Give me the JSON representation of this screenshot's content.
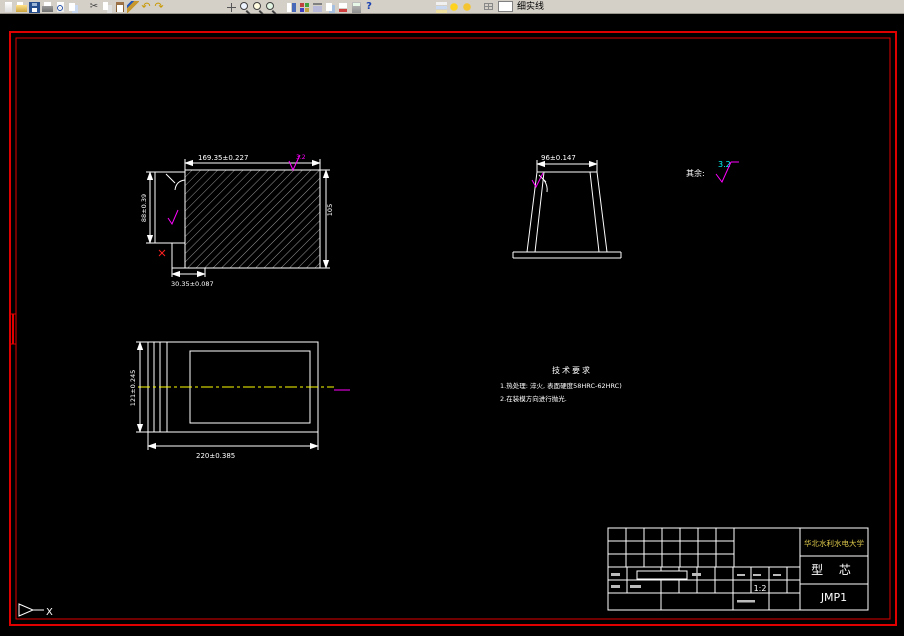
{
  "toolbar": {
    "icons": [
      "new",
      "open",
      "save",
      "plot",
      "preview",
      "publish",
      "sep",
      "cut",
      "copy",
      "paste",
      "match",
      "undo",
      "redo",
      "gap",
      "pan",
      "zoom-realtime",
      "zoom-window",
      "zoom-previous",
      "sep",
      "properties",
      "design-center",
      "tool-palettes",
      "sheet-set",
      "markup",
      "calc",
      "help",
      "gap",
      "layers",
      "layer-color",
      "express",
      "sep",
      "table"
    ],
    "linetype_label": "细实线"
  },
  "drawing": {
    "section_view": {
      "dim_top": "169.35±0.227",
      "dim_left": "88±0.39",
      "dim_right": "105",
      "dim_bottom": "30.35±0.087",
      "roughness": "3.2"
    },
    "front_view": {
      "dim_top": "96±0.147"
    },
    "plan_view": {
      "dim_bottom": "220±0.385",
      "dim_left": "121±0.245"
    },
    "surface_note": {
      "label": "其余:",
      "value": "3.2"
    },
    "tech_req": {
      "title": "技术要求",
      "line1": "1.热处理: 淬火, 表面硬度58HRC-62HRC)",
      "line2": "2.在装模方向进行抛光."
    },
    "title_block": {
      "school": "华北水利水电大学",
      "part": "型 芯",
      "code": "JMP1",
      "scale": "1:2"
    },
    "ucs_x_label": "X"
  }
}
